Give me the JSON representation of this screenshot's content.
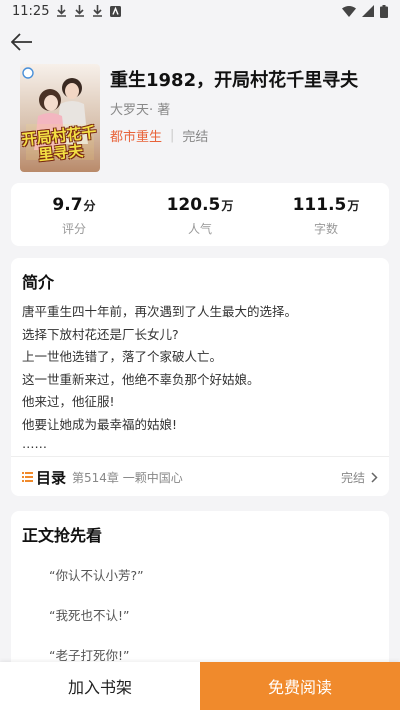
{
  "status_bar": {
    "time": "11:25"
  },
  "book": {
    "title": "重生1982，开局村花千里寻夫",
    "author": "大罗天· 著",
    "category": "都市重生",
    "state": "完结",
    "cover_text": "开局村花千里寻夫"
  },
  "stats": [
    {
      "value": "9.7",
      "unit": "分",
      "label": "评分"
    },
    {
      "value": "120.5",
      "unit": "万",
      "label": "人气"
    },
    {
      "value": "111.5",
      "unit": "万",
      "label": "字数"
    }
  ],
  "intro": {
    "heading": "简介",
    "lines": [
      "唐平重生四十年前，再次遇到了人生最大的选择。",
      "选择下放村花还是厂长女儿?",
      "上一世他选错了，落了个家破人亡。",
      "这一世重新来过，他绝不辜负那个好姑娘。",
      "他来过，他征服!",
      "他要让她成为最幸福的姑娘!",
      "……"
    ]
  },
  "toc": {
    "label": "目录",
    "latest_chapter": "第514章 一颗中国心",
    "state": "完结"
  },
  "preview": {
    "heading": "正文抢先看",
    "lines": [
      "“你认不认小芳?”",
      "“我死也不认!”",
      "“老子打死你!”"
    ]
  },
  "actions": {
    "add_shelf": "加入书架",
    "read_free": "免费阅读"
  },
  "colors": {
    "accent": "#f08a2c",
    "tag": "#e8633a"
  }
}
